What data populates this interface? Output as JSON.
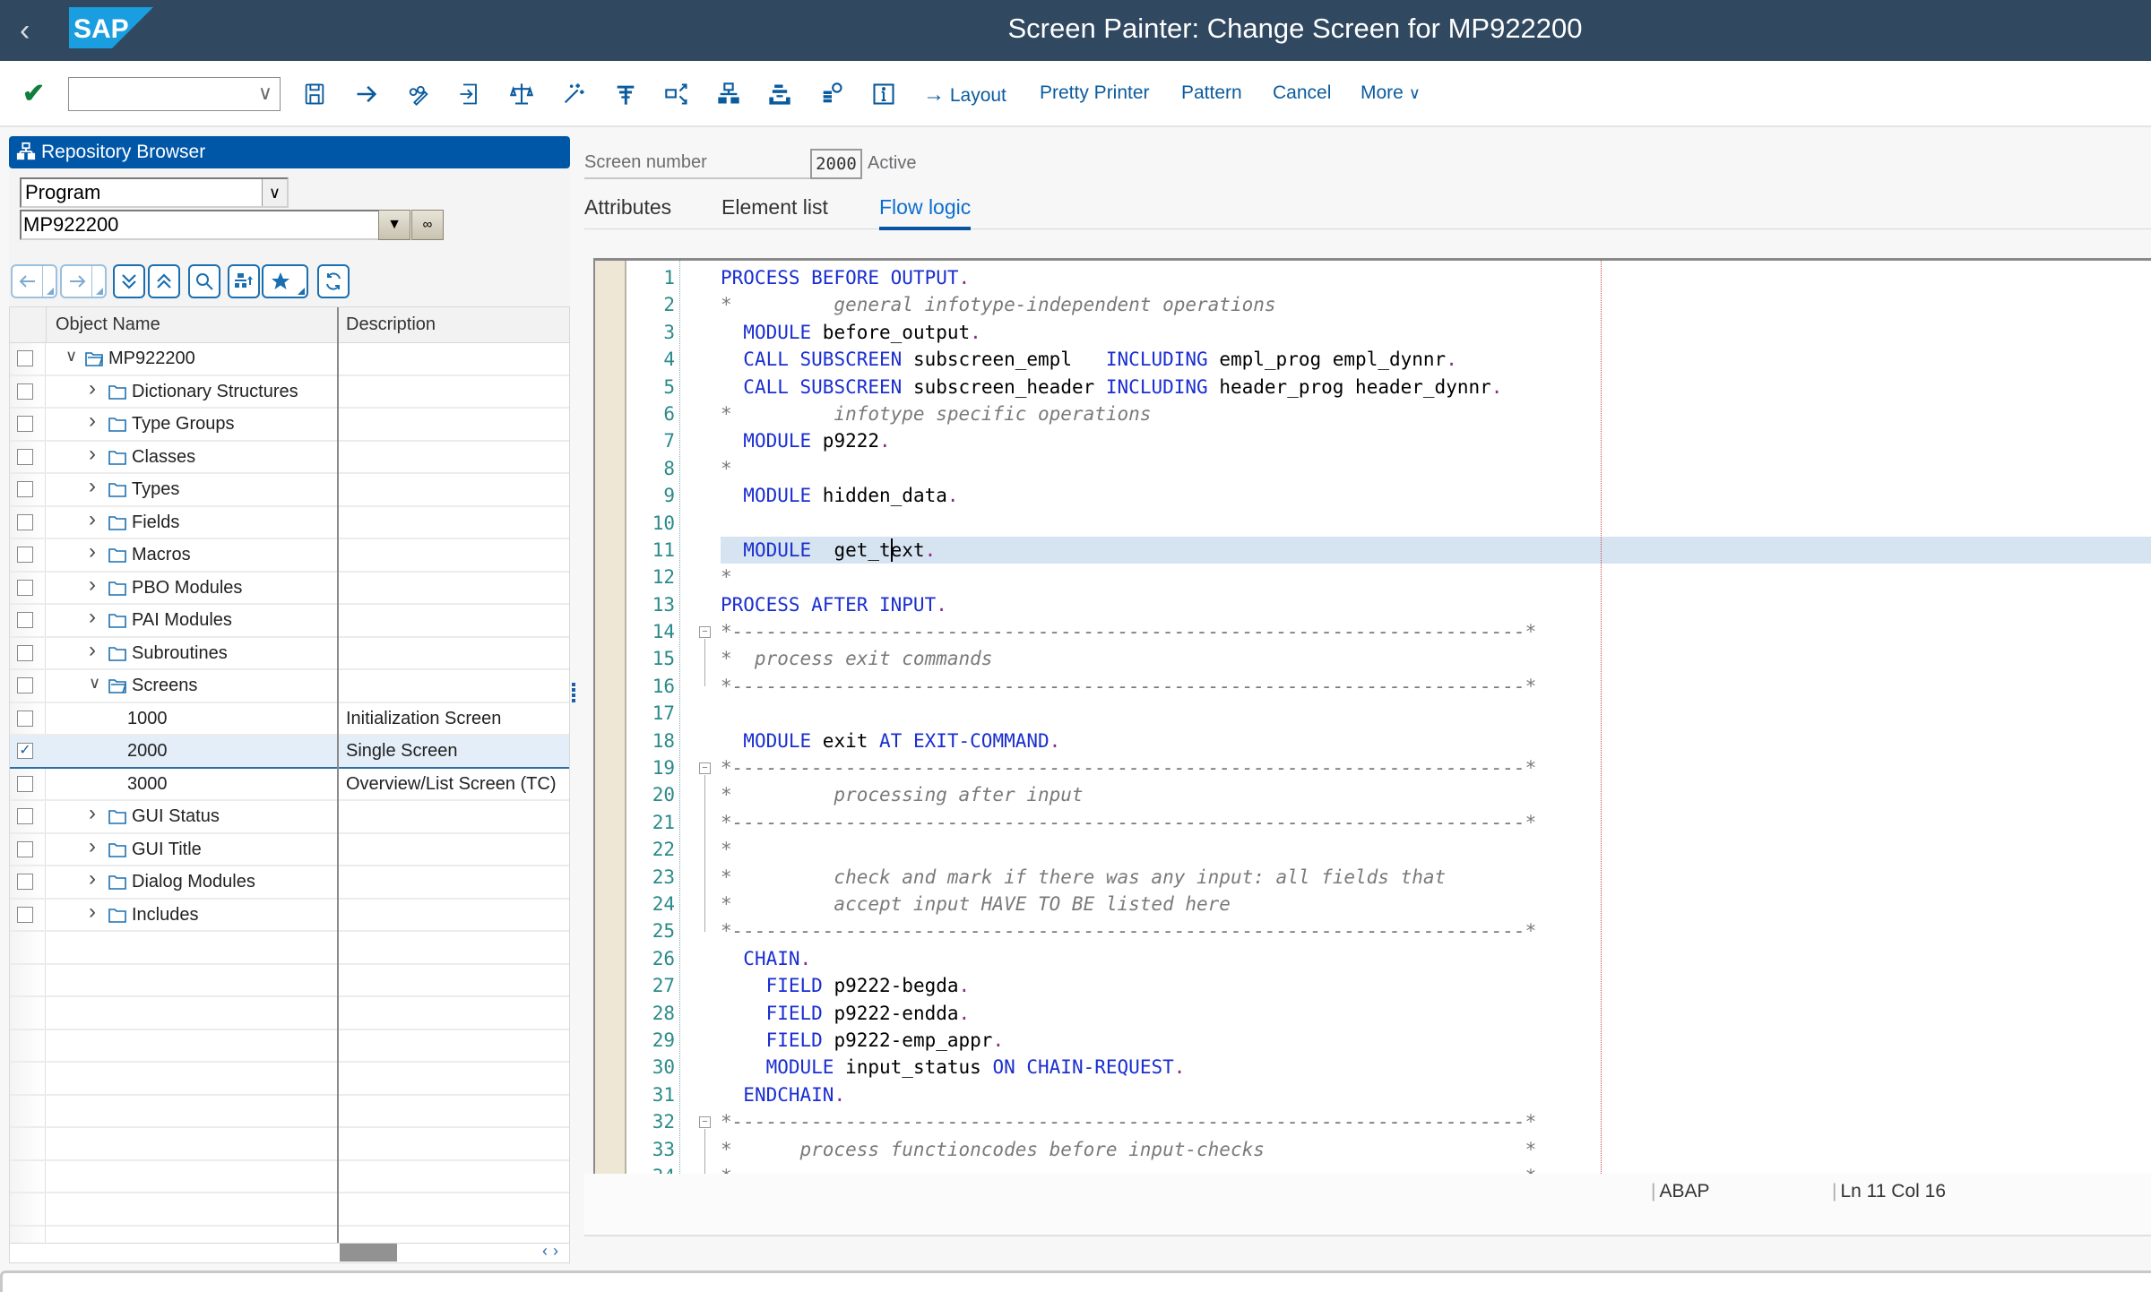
{
  "shell": {
    "title": "Screen Painter: Change Screen for MP922200",
    "logo_text": "SAP",
    "back_icon": "chevron-left-icon"
  },
  "toolbar": {
    "command_field_value": "",
    "icons": [
      "check-icon",
      "save-icon",
      "arrow-right-icon",
      "display-change-icon",
      "activate-icon",
      "check-syntax-icon",
      "magic-wand-icon",
      "where-used-icon",
      "fullscreen-icon",
      "hierarchy-icon",
      "stack-icon",
      "object-list-icon",
      "info-icon"
    ],
    "layout_label": "Layout",
    "pretty_printer_label": "Pretty Printer",
    "pattern_label": "Pattern",
    "cancel_label": "Cancel",
    "more_label": "More"
  },
  "repository_browser": {
    "title": "Repository Browser",
    "object_type": "Program",
    "object_name": "MP922200",
    "nav_buttons": [
      "back",
      "forward",
      "expand-all",
      "collapse-all",
      "find",
      "hierarchy-up",
      "favorites",
      "refresh"
    ],
    "columns": [
      "Object Name",
      "Description"
    ],
    "rows": [
      {
        "name": "MP922200",
        "desc": "",
        "level": 0,
        "expander": "open",
        "icon": "open-folder",
        "checked": false
      },
      {
        "name": "Dictionary Structures",
        "desc": "",
        "level": 1,
        "expander": "closed",
        "icon": "folder",
        "checked": false
      },
      {
        "name": "Type Groups",
        "desc": "",
        "level": 1,
        "expander": "closed",
        "icon": "folder",
        "checked": false
      },
      {
        "name": "Classes",
        "desc": "",
        "level": 1,
        "expander": "closed",
        "icon": "folder",
        "checked": false
      },
      {
        "name": "Types",
        "desc": "",
        "level": 1,
        "expander": "closed",
        "icon": "folder",
        "checked": false
      },
      {
        "name": "Fields",
        "desc": "",
        "level": 1,
        "expander": "closed",
        "icon": "folder",
        "checked": false
      },
      {
        "name": "Macros",
        "desc": "",
        "level": 1,
        "expander": "closed",
        "icon": "folder",
        "checked": false
      },
      {
        "name": "PBO Modules",
        "desc": "",
        "level": 1,
        "expander": "closed",
        "icon": "folder",
        "checked": false
      },
      {
        "name": "PAI Modules",
        "desc": "",
        "level": 1,
        "expander": "closed",
        "icon": "folder",
        "checked": false
      },
      {
        "name": "Subroutines",
        "desc": "",
        "level": 1,
        "expander": "closed",
        "icon": "folder",
        "checked": false
      },
      {
        "name": "Screens",
        "desc": "",
        "level": 1,
        "expander": "open",
        "icon": "open-folder",
        "checked": false
      },
      {
        "name": "1000",
        "desc": "Initialization Screen",
        "level": 2,
        "expander": "",
        "icon": "",
        "checked": false
      },
      {
        "name": "2000",
        "desc": "Single Screen",
        "level": 2,
        "expander": "",
        "icon": "",
        "checked": true,
        "selected": true
      },
      {
        "name": "3000",
        "desc": "Overview/List Screen (TC)",
        "level": 2,
        "expander": "",
        "icon": "",
        "checked": false
      },
      {
        "name": "GUI Status",
        "desc": "",
        "level": 1,
        "expander": "closed",
        "icon": "folder",
        "checked": false
      },
      {
        "name": "GUI Title",
        "desc": "",
        "level": 1,
        "expander": "closed",
        "icon": "folder",
        "checked": false
      },
      {
        "name": "Dialog Modules",
        "desc": "",
        "level": 1,
        "expander": "closed",
        "icon": "folder",
        "checked": false
      },
      {
        "name": "Includes",
        "desc": "",
        "level": 1,
        "expander": "closed",
        "icon": "folder",
        "checked": false
      }
    ],
    "empty_rows": 10
  },
  "screen": {
    "label": "Screen number",
    "number": "2000",
    "status": "Active"
  },
  "tabs": [
    {
      "label": "Attributes",
      "active": false
    },
    {
      "label": "Element list",
      "active": false
    },
    {
      "label": "Flow logic",
      "active": true
    }
  ],
  "editor": {
    "current_line": 11,
    "lines": [
      [
        [
          "kw",
          "PROCESS BEFORE OUTPUT"
        ],
        [
          "pt",
          "."
        ]
      ],
      [
        [
          "cm",
          "*         general infotype-independent operations"
        ]
      ],
      [
        [
          "t",
          "  "
        ],
        [
          "kw",
          "MODULE"
        ],
        [
          "t",
          " before_output"
        ],
        [
          "pt",
          "."
        ]
      ],
      [
        [
          "t",
          "  "
        ],
        [
          "kw",
          "CALL SUBSCREEN"
        ],
        [
          "t",
          " subscreen_empl   "
        ],
        [
          "kw",
          "INCLUDING"
        ],
        [
          "t",
          " empl_prog empl_dynnr"
        ],
        [
          "pt",
          "."
        ]
      ],
      [
        [
          "t",
          "  "
        ],
        [
          "kw",
          "CALL SUBSCREEN"
        ],
        [
          "t",
          " subscreen_header "
        ],
        [
          "kw",
          "INCLUDING"
        ],
        [
          "t",
          " header_prog header_dynnr"
        ],
        [
          "pt",
          "."
        ]
      ],
      [
        [
          "cm",
          "*         infotype specific operations"
        ]
      ],
      [
        [
          "t",
          "  "
        ],
        [
          "kw",
          "MODULE"
        ],
        [
          "t",
          " p9222"
        ],
        [
          "pt",
          "."
        ]
      ],
      [
        [
          "cm",
          "*"
        ]
      ],
      [
        [
          "t",
          "  "
        ],
        [
          "kw",
          "MODULE"
        ],
        [
          "t",
          " hidden_data"
        ],
        [
          "pt",
          "."
        ]
      ],
      [],
      [
        [
          "t",
          "  "
        ],
        [
          "kw",
          "MODULE"
        ],
        [
          "t",
          "  get_text"
        ],
        [
          "pt",
          "."
        ]
      ],
      [
        [
          "cm",
          "*"
        ]
      ],
      [
        [
          "kw",
          "PROCESS AFTER INPUT"
        ],
        [
          "pt",
          "."
        ]
      ],
      [
        [
          "cm",
          "*----------------------------------------------------------------------*"
        ]
      ],
      [
        [
          "cm",
          "*  process exit commands"
        ]
      ],
      [
        [
          "cm",
          "*----------------------------------------------------------------------*"
        ]
      ],
      [],
      [
        [
          "t",
          "  "
        ],
        [
          "kw",
          "MODULE"
        ],
        [
          "t",
          " exit "
        ],
        [
          "kw",
          "AT EXIT-COMMAND"
        ],
        [
          "pt",
          "."
        ]
      ],
      [
        [
          "cm",
          "*----------------------------------------------------------------------*"
        ]
      ],
      [
        [
          "cm",
          "*         processing after input"
        ]
      ],
      [
        [
          "cm",
          "*----------------------------------------------------------------------*"
        ]
      ],
      [
        [
          "cm",
          "*"
        ]
      ],
      [
        [
          "cm",
          "*         check and mark if there was any input: all fields that"
        ]
      ],
      [
        [
          "cm",
          "*         accept input HAVE TO BE listed here"
        ]
      ],
      [
        [
          "cm",
          "*----------------------------------------------------------------------*"
        ]
      ],
      [
        [
          "t",
          "  "
        ],
        [
          "kw",
          "CHAIN"
        ],
        [
          "pt",
          "."
        ]
      ],
      [
        [
          "t",
          "    "
        ],
        [
          "kw",
          "FIELD"
        ],
        [
          "t",
          " p9222-begda"
        ],
        [
          "pt",
          "."
        ]
      ],
      [
        [
          "t",
          "    "
        ],
        [
          "kw",
          "FIELD"
        ],
        [
          "t",
          " p9222-endda"
        ],
        [
          "pt",
          "."
        ]
      ],
      [
        [
          "t",
          "    "
        ],
        [
          "kw",
          "FIELD"
        ],
        [
          "t",
          " p9222-emp_appr"
        ],
        [
          "pt",
          "."
        ]
      ],
      [
        [
          "t",
          "    "
        ],
        [
          "kw",
          "MODULE"
        ],
        [
          "t",
          " input_status "
        ],
        [
          "kw",
          "ON CHAIN-REQUEST"
        ],
        [
          "pt",
          "."
        ]
      ],
      [
        [
          "t",
          "  "
        ],
        [
          "kw",
          "ENDCHAIN"
        ],
        [
          "pt",
          "."
        ]
      ],
      [
        [
          "cm",
          "*----------------------------------------------------------------------*"
        ]
      ],
      [
        [
          "cm",
          "*      process functioncodes before input-checks                       *"
        ]
      ],
      [
        [
          "cm",
          "*----------------------------------------------------------------------*"
        ]
      ]
    ],
    "fold_blocks": [
      [
        14,
        16
      ],
      [
        19,
        25
      ],
      [
        32,
        34
      ]
    ]
  },
  "statusbar": {
    "language": "ABAP",
    "position": "Ln  11 Col  16"
  }
}
